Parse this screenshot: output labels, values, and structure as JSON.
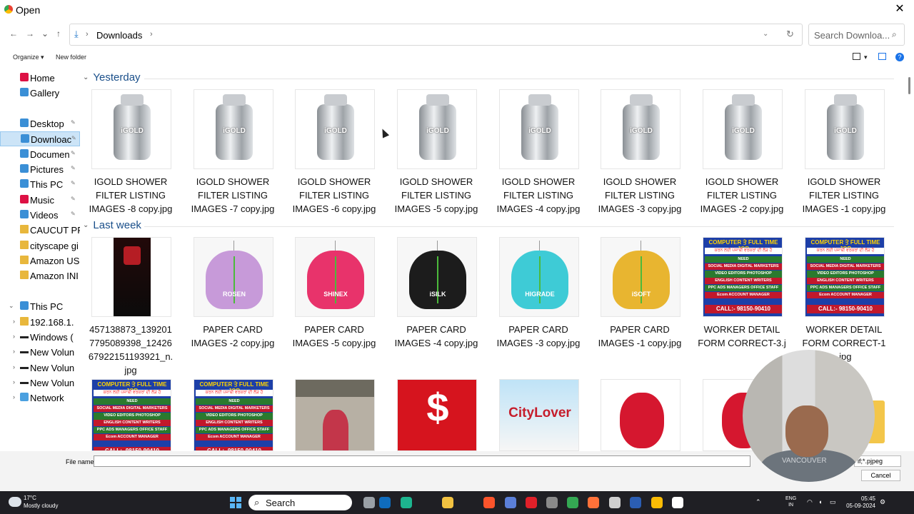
{
  "window": {
    "title": "Open",
    "close_label": "✕"
  },
  "nav": {
    "back": "←",
    "forward": "→",
    "recent": "⌄",
    "up": "↑",
    "location_icon": "download-icon",
    "breadcrumb": "Downloads",
    "sep": "›",
    "search_placeholder": "Search Downloa..."
  },
  "toolbar": {
    "organize": "Organize ▾",
    "new_folder": "New folder",
    "help": "?"
  },
  "sidebar": {
    "items": [
      {
        "label": "Home",
        "icon": "home-icon"
      },
      {
        "label": "Gallery",
        "icon": "gallery-icon"
      },
      {
        "label": "Desktop",
        "icon": "desktop-icon",
        "pinned": true
      },
      {
        "label": "Downloac",
        "icon": "download-icon",
        "pinned": true,
        "selected": true
      },
      {
        "label": "Documen",
        "icon": "documents-icon",
        "pinned": true
      },
      {
        "label": "Pictures",
        "icon": "pictures-icon",
        "pinned": true
      },
      {
        "label": "This PC",
        "icon": "this-pc-icon",
        "pinned": true
      },
      {
        "label": "Music",
        "icon": "music-icon",
        "pinned": true
      },
      {
        "label": "Videos",
        "icon": "videos-icon",
        "pinned": true
      },
      {
        "label": "CAUCUT PR",
        "icon": "folder-icon"
      },
      {
        "label": "cityscape gi",
        "icon": "folder-icon"
      },
      {
        "label": "Amazon US",
        "icon": "folder-icon"
      },
      {
        "label": "Amazon INI",
        "icon": "folder-icon"
      },
      {
        "label": "This PC",
        "icon": "this-pc-icon",
        "expanded": true
      },
      {
        "label": "192.168.1.",
        "icon": "network-drive-icon"
      },
      {
        "label": "Windows (",
        "icon": "drive-icon"
      },
      {
        "label": "New Volun",
        "icon": "drive-icon"
      },
      {
        "label": "New Volun",
        "icon": "drive-icon"
      },
      {
        "label": "New Volun",
        "icon": "drive-icon"
      },
      {
        "label": "Network",
        "icon": "network-icon"
      }
    ],
    "pin_glyph": "📌",
    "expand_glyph": "›",
    "expanded_glyph": "⌄"
  },
  "groups": [
    {
      "label": "Yesterday",
      "files": [
        "IGOLD SHOWER FILTER LISTING IMAGES -8 copy.jpg",
        "IGOLD SHOWER FILTER LISTING IMAGES -7 copy.jpg",
        "IGOLD SHOWER FILTER LISTING IMAGES -6 copy.jpg",
        "IGOLD SHOWER FILTER LISTING IMAGES -5 copy.jpg",
        "IGOLD SHOWER FILTER LISTING IMAGES -4 copy.jpg",
        "IGOLD SHOWER FILTER LISTING IMAGES -3 copy.jpg",
        "IGOLD SHOWER FILTER LISTING IMAGES -2 copy.jpg",
        "IGOLD SHOWER FILTER LISTING IMAGES -1 copy.jpg"
      ]
    },
    {
      "label": "Last week",
      "files": [
        "457138873_139201 7795089398_12426 67922151193921_n. jpg",
        "PAPER CARD IMAGES -2 copy.jpg",
        "PAPER CARD IMAGES -5 copy.jpg",
        "PAPER CARD IMAGES -4 copy.jpg",
        "PAPER CARD IMAGES -3 copy.jpg",
        "PAPER CARD IMAGES -1 copy.jpg",
        "WORKER DETAIL FORM CORRECT-3.j",
        "WORKER DETAIL FORM CORRECT-1 .jpg"
      ]
    }
  ],
  "thumb_text": {
    "igold": "iGOLD",
    "card_names": [
      "ROSEN",
      "SHINEX",
      "iSILK",
      "HIGRADE",
      "iSOFT"
    ],
    "poster_title": "COMPUTER ਤੇ FULL TIME JOB",
    "poster_sub": "ਕਰਨ ਲਈ ਪੰਜਾਬੀ ਵਰਕਰਾਂ ਦੀ ਲੋੜ ਹੈ",
    "poster_lines": [
      "NEED",
      "SOCIAL MEDIA DIGITAL MARKETERS",
      "VIDEO EDITORS PHOTOSHOP DESIGNERS",
      "ENGLISH CONTENT WRITERS",
      "PPC ADS MANAGERS OFFICE STAFF",
      "Ecom ACCOUNT MANAGER"
    ],
    "poster_call": "CALL:- 98150-90410",
    "citylover": "CityLover",
    "dollar": "$"
  },
  "colors": {
    "igold_bg": "#ffffff",
    "card_colors": [
      "#c79ad9",
      "#e8336b",
      "#1c1c1c",
      "#3ecbd6",
      "#e8b530"
    ],
    "poster_bg": "#1d3fa8",
    "poster_title": "#ffd400",
    "poster_sub": "#ff2b2b",
    "dollar_bg": "#d6141e",
    "scarf": "#d5172f"
  },
  "bottom": {
    "file_name_label": "File name:",
    "filter_value": "if;*.pjpeg",
    "cancel_label": "Cancel"
  },
  "webcam": {
    "shirt_text": "VANCOUVER"
  },
  "taskbar": {
    "temperature": "17°C",
    "weather": "Mostly cloudy",
    "search_label": "Search",
    "lang_1": "ENG",
    "lang_2": "IN",
    "time": "05:45",
    "date": "05-09-2024"
  }
}
